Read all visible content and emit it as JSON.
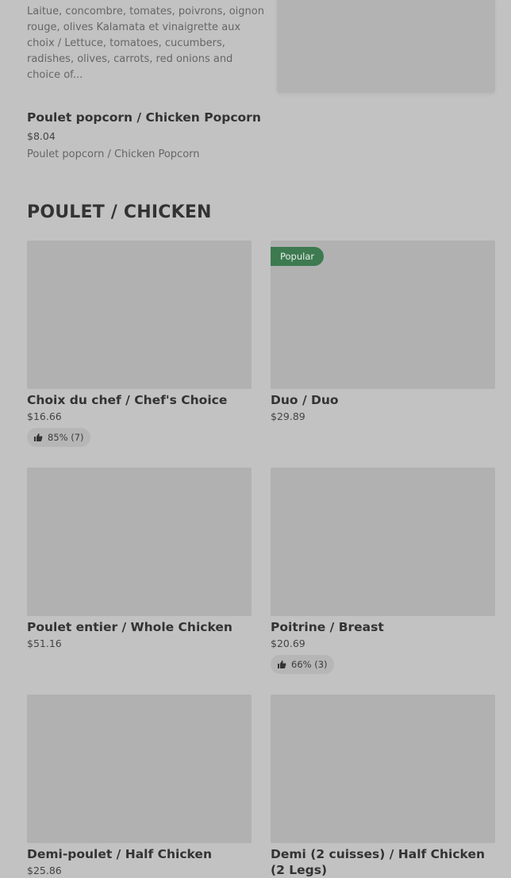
{
  "top_item": {
    "description": "Laitue, concombre, tomates, poivrons, oignon rouge, olives Kalamata et vinaigrette aux choix / Lettuce, tomatoes, cucumbers, radishes, olives, carrots, red onions and choice of..."
  },
  "popcorn": {
    "title": "Poulet popcorn / Chicken Popcorn",
    "price": "$8.04",
    "description": "Poulet popcorn / Chicken Popcorn"
  },
  "section": {
    "title": "POULET / CHICKEN"
  },
  "cards": [
    {
      "title": "Choix du chef / Chef's Choice",
      "price": "$16.66",
      "rating": "85% (7)"
    },
    {
      "title": "Duo / Duo",
      "price": "$29.89",
      "badge": "Popular"
    },
    {
      "title": "Poulet entier / Whole Chicken",
      "price": "$51.16"
    },
    {
      "title": "Poitrine / Breast",
      "price": "$20.69",
      "rating": "66% (3)"
    },
    {
      "title": "Demi-poulet / Half Chicken",
      "price": "$25.86"
    },
    {
      "title": "Demi (2 cuisses) / Half Chicken (2 Legs)",
      "price": ""
    }
  ],
  "icons": {
    "thumbs_up": "thumbs-up-icon"
  },
  "colors": {
    "background": "#c2c2c2",
    "image_placeholder": "#b1b1b1",
    "badge": "#3d7a50"
  }
}
